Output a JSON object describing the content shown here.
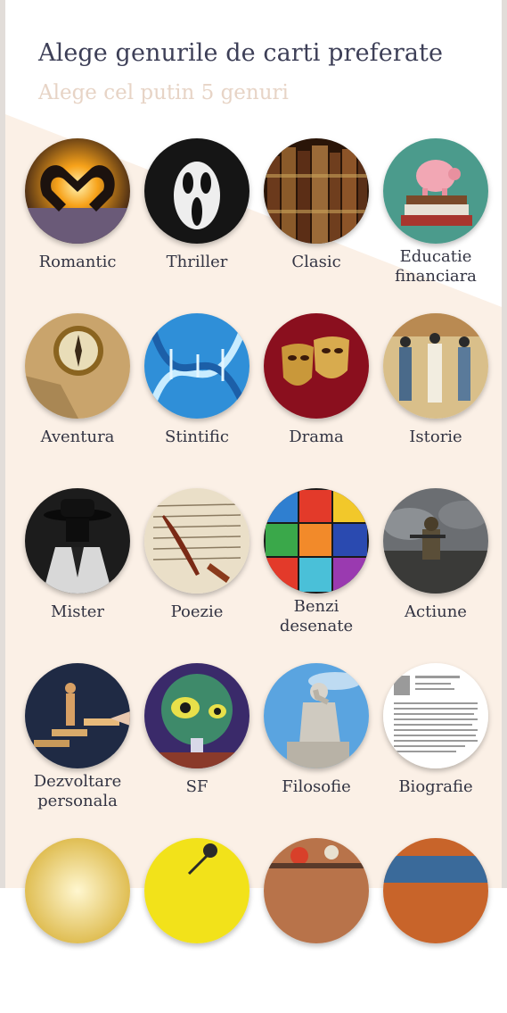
{
  "header": {
    "title": "Alege genurile de carti preferate",
    "subtitle": "Alege cel putin 5 genuri"
  },
  "colors": {
    "background": "#fbf0e6",
    "title": "#3d3f57",
    "subtitle": "#e7d4c6"
  },
  "genres": [
    {
      "id": "romantic",
      "label": "Romantic",
      "icon": "heart-hands-image"
    },
    {
      "id": "thriller",
      "label": "Thriller",
      "icon": "ghost-mask-image"
    },
    {
      "id": "clasic",
      "label": "Clasic",
      "icon": "old-books-image"
    },
    {
      "id": "educatie-financiara",
      "label": "Educatie financiara",
      "icon": "piggy-bank-image"
    },
    {
      "id": "aventura",
      "label": "Aventura",
      "icon": "compass-image"
    },
    {
      "id": "stiintific",
      "label": "Stintific",
      "icon": "dna-image"
    },
    {
      "id": "drama",
      "label": "Drama",
      "icon": "theater-masks-image"
    },
    {
      "id": "istorie",
      "label": "Istorie",
      "icon": "egyptian-art-image"
    },
    {
      "id": "mister",
      "label": "Mister",
      "icon": "detective-image"
    },
    {
      "id": "poezie",
      "label": "Poezie",
      "icon": "quill-letter-image"
    },
    {
      "id": "benzi-desenate",
      "label": "Benzi desenate",
      "icon": "comics-image"
    },
    {
      "id": "actiune",
      "label": "Actiune",
      "icon": "soldier-image"
    },
    {
      "id": "dezvoltare-personala",
      "label": "Dezvoltare personala",
      "icon": "stairs-image"
    },
    {
      "id": "sf",
      "label": "SF",
      "icon": "alien-image"
    },
    {
      "id": "filosofie",
      "label": "Filosofie",
      "icon": "thinker-statue-image"
    },
    {
      "id": "biografie",
      "label": "Biografie",
      "icon": "biography-page-image"
    },
    {
      "id": "more-1",
      "label": "",
      "icon": "sunset-image"
    },
    {
      "id": "more-2",
      "label": "",
      "icon": "microphone-image"
    },
    {
      "id": "more-3",
      "label": "",
      "icon": "food-image"
    },
    {
      "id": "more-4",
      "label": "",
      "icon": "landscape-image"
    }
  ]
}
